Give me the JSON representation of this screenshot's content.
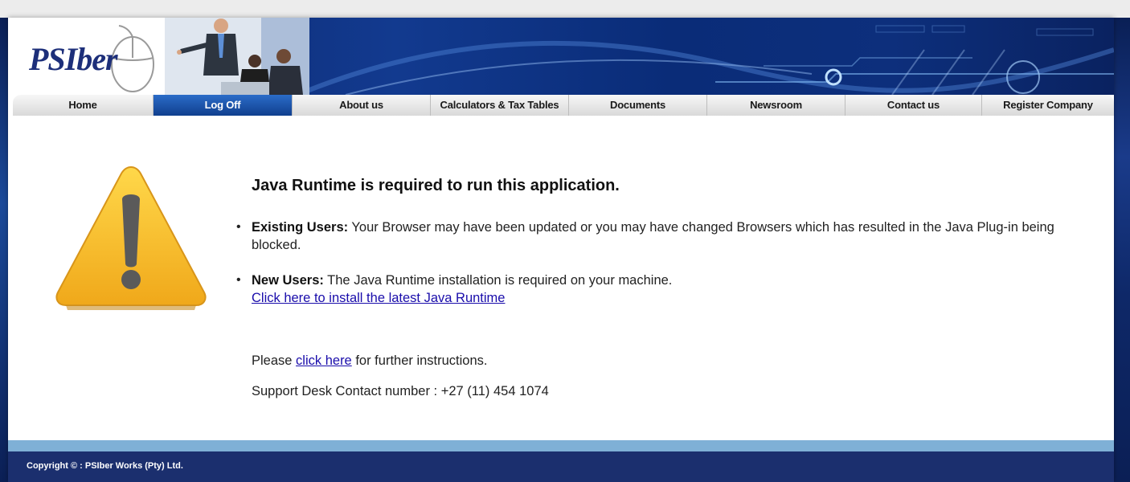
{
  "brand": {
    "logo_text": "PSIber"
  },
  "nav": {
    "items": [
      {
        "label": "Home"
      },
      {
        "label": "Log Off"
      },
      {
        "label": "About us"
      },
      {
        "label": "Calculators & Tax Tables"
      },
      {
        "label": "Documents"
      },
      {
        "label": "Newsroom"
      },
      {
        "label": "Contact us"
      },
      {
        "label": "Register Company"
      }
    ],
    "active": "Log Off"
  },
  "main": {
    "heading": "Java Runtime is required to run this application.",
    "existing": {
      "label": "Existing Users:",
      "text": "Your Browser may have been updated or you may have changed Browsers which has resulted in the Java Plug-in being blocked."
    },
    "new_users": {
      "label": "New Users:",
      "text": "The Java Runtime installation is required on your machine.",
      "link": "Click here to install the latest Java Runtime"
    },
    "instructions": {
      "prefix": "Please",
      "link": "click here",
      "suffix": "for further instructions."
    },
    "support": "Support Desk Contact number : +27 (11) 454 1074"
  },
  "footer": {
    "copyright": "Copyright © : PSIber Works (Pty) Ltd."
  },
  "colors": {
    "banner": "#0c2466",
    "nav_active": "#103f8e",
    "footer": "#1b2f6e",
    "footer_stripe": "#7fb0d6",
    "warning": "#f6b81f",
    "link": "#1a0dab"
  },
  "icons": {
    "warning": "warning-triangle-icon",
    "mouse": "mouse-icon"
  }
}
